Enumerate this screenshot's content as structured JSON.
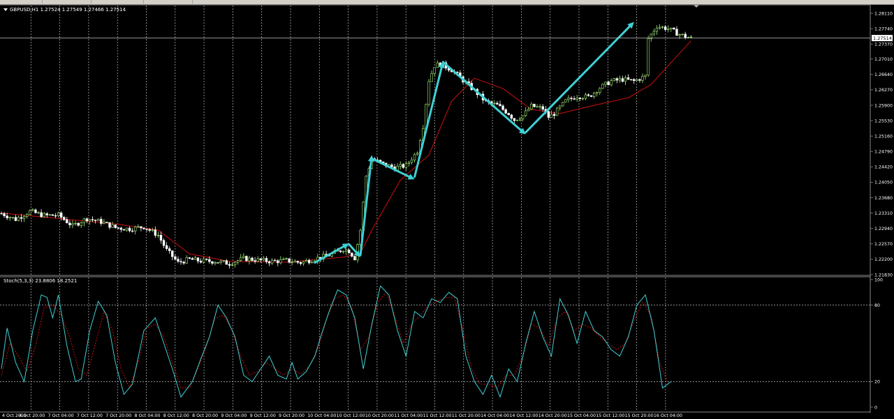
{
  "window": {
    "symbol_info": "GBPUSD,H1  1.27524 1.27549 1.27466 1.27514"
  },
  "colors": {
    "background": "#000000",
    "grid": "#c0c0c0",
    "bull_candle": "#a6f07a",
    "bear_candle": "#ffffff",
    "moving_average": "#cc1010",
    "arrows": "#3fd0d4",
    "stoch_main": "#3fd0d4",
    "stoch_signal": "#cc1010",
    "axis_text": "#ffffff",
    "current_price_box": "#ffffff"
  },
  "chart_data": [
    {
      "type": "candlestick",
      "title": "GBPUSD,H1",
      "current_price": 1.27514,
      "ylim": [
        1.2183,
        1.2811
      ],
      "y_ticks": [
        "1.28110",
        "1.27740",
        "1.27370",
        "1.27010",
        "1.26640",
        "1.26270",
        "1.25900",
        "1.25530",
        "1.25160",
        "1.24790",
        "1.24420",
        "1.24050",
        "1.23680",
        "1.23310",
        "1.22940",
        "1.22570",
        "1.22200",
        "1.21830"
      ],
      "x_ticks": [
        "4 Oct 2019",
        "4 Oct 20:00",
        "7 Oct 04:00",
        "7 Oct 12:00",
        "7 Oct 20:00",
        "8 Oct 04:00",
        "8 Oct 12:00",
        "8 Oct 20:00",
        "9 Oct 04:00",
        "9 Oct 12:00",
        "9 Oct 20:00",
        "10 Oct 04:00",
        "10 Oct 12:00",
        "10 Oct 20:00",
        "11 Oct 04:00",
        "11 Oct 12:00",
        "11 Oct 20:00",
        "14 Oct 04:00",
        "14 Oct 12:00",
        "14 Oct 20:00",
        "15 Oct 04:00",
        "15 Oct 12:00",
        "15 Oct 20:00",
        "16 Oct 04:00"
      ],
      "price_path": [
        [
          0,
          1.233
        ],
        [
          5,
          1.2316
        ],
        [
          10,
          1.2335
        ],
        [
          15,
          1.2325
        ],
        [
          20,
          1.2326
        ],
        [
          25,
          1.23
        ],
        [
          30,
          1.2318
        ],
        [
          35,
          1.231
        ],
        [
          40,
          1.2296
        ],
        [
          45,
          1.2293
        ],
        [
          50,
          1.2298
        ],
        [
          55,
          1.2278
        ],
        [
          58,
          1.2242
        ],
        [
          62,
          1.2212
        ],
        [
          66,
          1.222
        ],
        [
          70,
          1.2216
        ],
        [
          75,
          1.2215
        ],
        [
          80,
          1.221
        ],
        [
          85,
          1.2222
        ],
        [
          90,
          1.2218
        ],
        [
          95,
          1.2215
        ],
        [
          100,
          1.2217
        ],
        [
          105,
          1.2212
        ],
        [
          110,
          1.2221
        ],
        [
          115,
          1.223
        ],
        [
          120,
          1.2244
        ],
        [
          122,
          1.224
        ],
        [
          124,
          1.2223
        ],
        [
          126,
          1.229
        ],
        [
          128,
          1.242
        ],
        [
          130,
          1.2462
        ],
        [
          134,
          1.2448
        ],
        [
          138,
          1.244
        ],
        [
          142,
          1.2445
        ],
        [
          146,
          1.248
        ],
        [
          148,
          1.254
        ],
        [
          150,
          1.265
        ],
        [
          152,
          1.2685
        ],
        [
          154,
          1.269
        ],
        [
          158,
          1.2675
        ],
        [
          162,
          1.265
        ],
        [
          166,
          1.2625
        ],
        [
          170,
          1.2598
        ],
        [
          174,
          1.259
        ],
        [
          178,
          1.257
        ],
        [
          180,
          1.2555
        ],
        [
          183,
          1.2565
        ],
        [
          186,
          1.2588
        ],
        [
          190,
          1.2582
        ],
        [
          192,
          1.2562
        ],
        [
          194,
          1.257
        ],
        [
          198,
          1.26
        ],
        [
          202,
          1.2612
        ],
        [
          206,
          1.261
        ],
        [
          210,
          1.2632
        ],
        [
          214,
          1.2648
        ],
        [
          218,
          1.2652
        ],
        [
          222,
          1.2648
        ],
        [
          226,
          1.266
        ],
        [
          227,
          1.275
        ],
        [
          230,
          1.278
        ],
        [
          234,
          1.2774
        ],
        [
          238,
          1.276
        ],
        [
          242,
          1.2751
        ]
      ],
      "moving_average": [
        [
          0,
          1.2331
        ],
        [
          20,
          1.2318
        ],
        [
          40,
          1.2305
        ],
        [
          55,
          1.229
        ],
        [
          66,
          1.2233
        ],
        [
          80,
          1.2215
        ],
        [
          100,
          1.2213
        ],
        [
          120,
          1.2225
        ],
        [
          126,
          1.2235
        ],
        [
          130,
          1.229
        ],
        [
          140,
          1.241
        ],
        [
          150,
          1.247
        ],
        [
          158,
          1.26
        ],
        [
          166,
          1.2655
        ],
        [
          176,
          1.263
        ],
        [
          186,
          1.258
        ],
        [
          196,
          1.257
        ],
        [
          208,
          1.259
        ],
        [
          220,
          1.2608
        ],
        [
          228,
          1.264
        ],
        [
          236,
          1.27
        ],
        [
          242,
          1.2745
        ]
      ],
      "arrows": [
        {
          "from": [
            110,
            1.2212
          ],
          "to": [
            122,
            1.2258
          ]
        },
        {
          "from": [
            122,
            1.2256
          ],
          "to": [
            126,
            1.2225
          ]
        },
        {
          "from": [
            126,
            1.223
          ],
          "to": [
            130,
            1.247
          ]
        },
        {
          "from": [
            130,
            1.2462
          ],
          "to": [
            145,
            1.2412
          ]
        },
        {
          "from": [
            145,
            1.2418
          ],
          "to": [
            155,
            1.2695
          ]
        },
        {
          "from": [
            155,
            1.2694
          ],
          "to": [
            184,
            1.252
          ]
        },
        {
          "from": [
            184,
            1.2525
          ],
          "to": [
            222,
            1.279
          ]
        }
      ]
    },
    {
      "type": "line",
      "title": "Stoch(5,3,3) 23.8806 18.2521",
      "ylim": [
        0,
        100
      ],
      "y_ticks": [
        "100",
        "80",
        "20",
        "0"
      ],
      "levels": [
        80,
        20
      ],
      "series": [
        {
          "name": "main",
          "values": [
            [
              0,
              30
            ],
            [
              2,
              62
            ],
            [
              5,
              35
            ],
            [
              8,
              20
            ],
            [
              11,
              60
            ],
            [
              14,
              88
            ],
            [
              16,
              86
            ],
            [
              18,
              70
            ],
            [
              20,
              88
            ],
            [
              23,
              48
            ],
            [
              26,
              20
            ],
            [
              28,
              22
            ],
            [
              31,
              60
            ],
            [
              34,
              83
            ],
            [
              37,
              72
            ],
            [
              40,
              35
            ],
            [
              43,
              10
            ],
            [
              46,
              18
            ],
            [
              50,
              60
            ],
            [
              54,
              70
            ],
            [
              57,
              50
            ],
            [
              60,
              30
            ],
            [
              63,
              8
            ],
            [
              67,
              20
            ],
            [
              70,
              38
            ],
            [
              73,
              55
            ],
            [
              76,
              80
            ],
            [
              79,
              70
            ],
            [
              82,
              55
            ],
            [
              85,
              25
            ],
            [
              88,
              20
            ],
            [
              91,
              30
            ],
            [
              94,
              40
            ],
            [
              97,
              25
            ],
            [
              100,
              22
            ],
            [
              102,
              35
            ],
            [
              104,
              22
            ],
            [
              107,
              28
            ],
            [
              110,
              40
            ],
            [
              112,
              55
            ],
            [
              115,
              75
            ],
            [
              118,
              92
            ],
            [
              121,
              88
            ],
            [
              124,
              70
            ],
            [
              127,
              30
            ],
            [
              130,
              65
            ],
            [
              133,
              95
            ],
            [
              136,
              88
            ],
            [
              139,
              60
            ],
            [
              142,
              40
            ],
            [
              145,
              75
            ],
            [
              148,
              70
            ],
            [
              151,
              85
            ],
            [
              154,
              82
            ],
            [
              157,
              90
            ],
            [
              160,
              85
            ],
            [
              163,
              40
            ],
            [
              166,
              20
            ],
            [
              169,
              10
            ],
            [
              172,
              25
            ],
            [
              175,
              8
            ],
            [
              178,
              30
            ],
            [
              181,
              20
            ],
            [
              184,
              50
            ],
            [
              187,
              75
            ],
            [
              190,
              55
            ],
            [
              193,
              40
            ],
            [
              196,
              85
            ],
            [
              199,
              72
            ],
            [
              202,
              50
            ],
            [
              205,
              75
            ],
            [
              208,
              60
            ],
            [
              211,
              55
            ],
            [
              214,
              45
            ],
            [
              217,
              40
            ],
            [
              220,
              55
            ],
            [
              223,
              80
            ],
            [
              226,
              88
            ],
            [
              229,
              60
            ],
            [
              232,
              15
            ],
            [
              235,
              20
            ]
          ]
        },
        {
          "name": "signal",
          "values": [
            [
              0,
              25
            ],
            [
              3,
              50
            ],
            [
              6,
              40
            ],
            [
              9,
              28
            ],
            [
              12,
              48
            ],
            [
              15,
              78
            ],
            [
              18,
              80
            ],
            [
              21,
              72
            ],
            [
              24,
              55
            ],
            [
              27,
              30
            ],
            [
              30,
              25
            ],
            [
              33,
              50
            ],
            [
              36,
              75
            ],
            [
              39,
              60
            ],
            [
              42,
              30
            ],
            [
              45,
              15
            ],
            [
              48,
              35
            ],
            [
              51,
              62
            ],
            [
              54,
              65
            ],
            [
              57,
              55
            ],
            [
              60,
              35
            ],
            [
              63,
              15
            ],
            [
              66,
              15
            ],
            [
              69,
              30
            ],
            [
              72,
              48
            ],
            [
              75,
              70
            ],
            [
              78,
              72
            ],
            [
              81,
              60
            ],
            [
              84,
              40
            ],
            [
              87,
              25
            ],
            [
              90,
              28
            ],
            [
              93,
              35
            ],
            [
              96,
              30
            ],
            [
              99,
              25
            ],
            [
              102,
              30
            ],
            [
              105,
              26
            ],
            [
              108,
              32
            ],
            [
              111,
              45
            ],
            [
              114,
              68
            ],
            [
              117,
              85
            ],
            [
              120,
              88
            ],
            [
              123,
              78
            ],
            [
              126,
              45
            ],
            [
              129,
              55
            ],
            [
              132,
              82
            ],
            [
              135,
              90
            ],
            [
              138,
              72
            ],
            [
              141,
              50
            ],
            [
              144,
              65
            ],
            [
              147,
              72
            ],
            [
              150,
              80
            ],
            [
              153,
              83
            ],
            [
              156,
              86
            ],
            [
              159,
              86
            ],
            [
              162,
              60
            ],
            [
              165,
              30
            ],
            [
              168,
              18
            ],
            [
              171,
              18
            ],
            [
              174,
              15
            ],
            [
              177,
              25
            ],
            [
              180,
              25
            ],
            [
              183,
              40
            ],
            [
              186,
              65
            ],
            [
              189,
              62
            ],
            [
              192,
              48
            ],
            [
              195,
              70
            ],
            [
              198,
              75
            ],
            [
              201,
              60
            ],
            [
              204,
              65
            ],
            [
              207,
              62
            ],
            [
              210,
              55
            ],
            [
              213,
              50
            ],
            [
              216,
              45
            ],
            [
              219,
              50
            ],
            [
              222,
              68
            ],
            [
              225,
              82
            ],
            [
              228,
              72
            ],
            [
              231,
              35
            ],
            [
              234,
              18
            ]
          ]
        }
      ]
    }
  ]
}
